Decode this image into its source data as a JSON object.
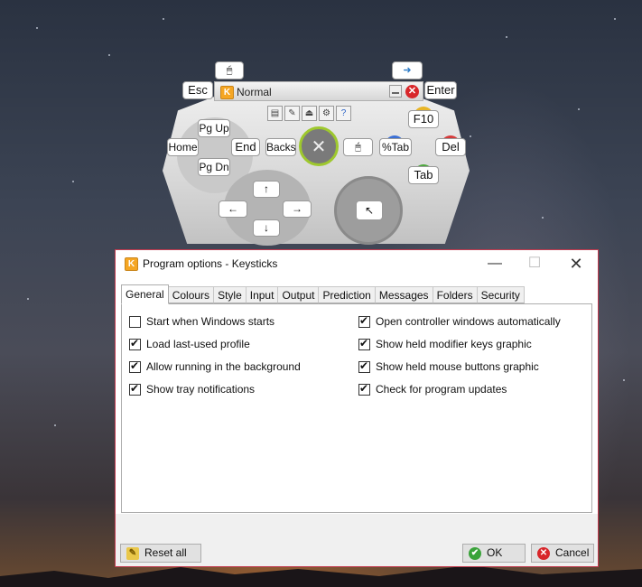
{
  "controller": {
    "title": "Normal",
    "keys": {
      "esc": "Esc",
      "enter": "Enter",
      "pgup": "Pg Up",
      "pgdn": "Pg Dn",
      "home": "Home",
      "end": "End",
      "backs": "Backs",
      "f10": "F10",
      "pcttab": "%Tab",
      "del": "Del",
      "tab": "Tab"
    },
    "dpad_arrows": [
      "↑",
      "←",
      "→",
      "↓"
    ],
    "icons": [
      "mouse-icon",
      "export-icon",
      "folder-icon",
      "edit-icon",
      "eject-icon",
      "settings-icon",
      "help-icon",
      "cursor-icon"
    ],
    "face_button_colors": {
      "y": "#e8b526",
      "x": "#3a6fd6",
      "b": "#d63a3a",
      "a": "#4ca83c"
    },
    "accent_color": "#9ec82e"
  },
  "dialog": {
    "title": "Program options - Keysticks",
    "tabs": [
      "General",
      "Colours",
      "Style",
      "Input",
      "Output",
      "Prediction",
      "Messages",
      "Folders",
      "Security"
    ],
    "active_tab": "General",
    "options_left": [
      {
        "label": "Start when Windows starts",
        "checked": false
      },
      {
        "label": "Load last-used profile",
        "checked": true
      },
      {
        "label": "Allow running in the background",
        "checked": true
      },
      {
        "label": "Show tray notifications",
        "checked": true
      }
    ],
    "options_right": [
      {
        "label": "Open controller windows automatically",
        "checked": true
      },
      {
        "label": "Show held modifier keys graphic",
        "checked": true
      },
      {
        "label": "Show held mouse buttons graphic",
        "checked": true
      },
      {
        "label": "Check for program updates",
        "checked": true
      }
    ],
    "buttons": {
      "reset": "Reset all",
      "ok": "OK",
      "cancel": "Cancel"
    },
    "border_color": "#c23a4e"
  }
}
